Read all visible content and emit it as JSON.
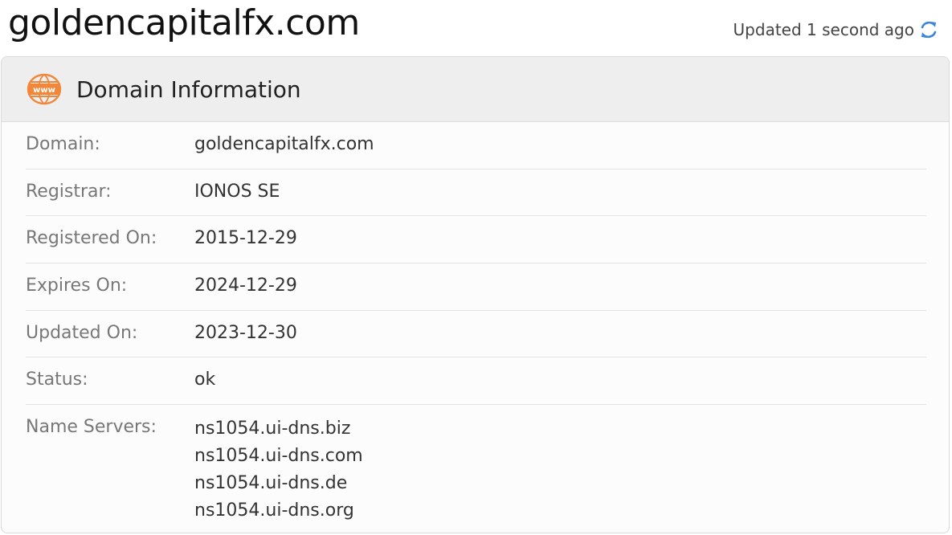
{
  "page": {
    "title": "goldencapitalfx.com",
    "updated_text": "Updated 1 second ago"
  },
  "colors": {
    "accent_orange": "#f0873a",
    "refresh_blue": "#3a86d9"
  },
  "icons": {
    "refresh": "refresh-icon",
    "www": "www-globe-icon"
  },
  "card": {
    "title": "Domain Information",
    "rows": [
      {
        "label": "Domain:",
        "value": "goldencapitalfx.com"
      },
      {
        "label": "Registrar:",
        "value": "IONOS SE"
      },
      {
        "label": "Registered On:",
        "value": "2015-12-29"
      },
      {
        "label": "Expires On:",
        "value": "2024-12-29"
      },
      {
        "label": "Updated On:",
        "value": "2023-12-30"
      },
      {
        "label": "Status:",
        "value": "ok"
      }
    ],
    "name_servers": {
      "label": "Name Servers:",
      "values": [
        "ns1054.ui-dns.biz",
        "ns1054.ui-dns.com",
        "ns1054.ui-dns.de",
        "ns1054.ui-dns.org"
      ]
    }
  }
}
